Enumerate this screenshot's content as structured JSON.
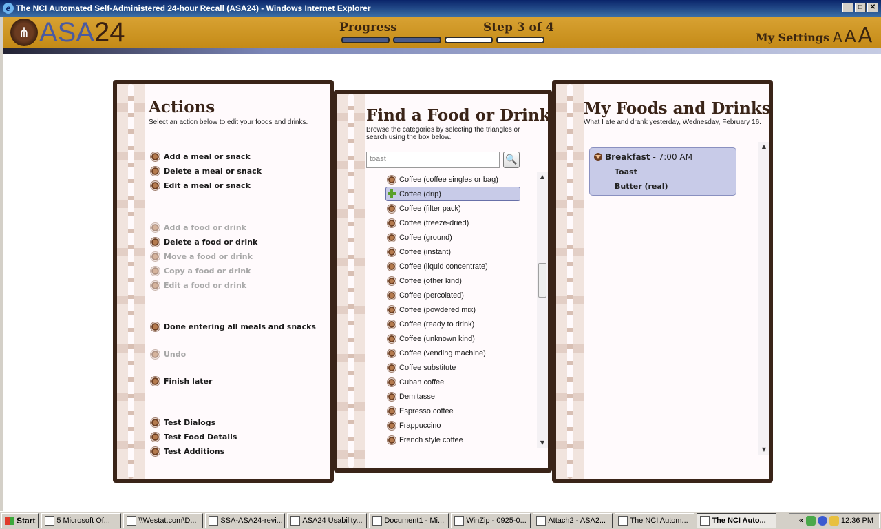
{
  "window": {
    "title": "The NCI Automated Self-Administered 24-hour Recall (ASA24) - Windows Internet Explorer"
  },
  "header": {
    "logo_text": "ASA",
    "logo_number": "24",
    "progress_label": "Progress",
    "step_label": "Step 3 of 4",
    "progress_completed": 2,
    "progress_total": 4,
    "my_settings": "My Settings",
    "font_size_small": "A",
    "font_size_medium": "A",
    "font_size_large": "A"
  },
  "actions_panel": {
    "title": "Actions",
    "subtitle": "Select an action below to edit your foods and drinks.",
    "items": [
      {
        "label": "Add a meal or snack",
        "enabled": true
      },
      {
        "label": "Delete a meal or snack",
        "enabled": true
      },
      {
        "label": "Edit a meal or snack",
        "enabled": true
      },
      {
        "label": "Add a food or drink",
        "enabled": false
      },
      {
        "label": "Delete a food or drink",
        "enabled": true
      },
      {
        "label": "Move a food or drink",
        "enabled": false
      },
      {
        "label": "Copy a food or drink",
        "enabled": false
      },
      {
        "label": "Edit a food or drink",
        "enabled": false
      },
      {
        "label": "Done entering all meals and snacks",
        "enabled": true
      },
      {
        "label": "Undo",
        "enabled": false
      },
      {
        "label": "Finish later",
        "enabled": true
      },
      {
        "label": "Test Dialogs",
        "enabled": true
      },
      {
        "label": "Test Food Details",
        "enabled": true
      },
      {
        "label": "Test Additions",
        "enabled": true
      }
    ]
  },
  "find_panel": {
    "title": "Find a Food or Drink",
    "subtitle": "Browse the categories by selecting the triangles or search using the box below.",
    "search_value": "toast",
    "foods": [
      "Coffee (coffee singles or bag)",
      "Coffee (drip)",
      "Coffee (filter pack)",
      "Coffee (freeze-dried)",
      "Coffee (ground)",
      "Coffee (instant)",
      "Coffee (liquid concentrate)",
      "Coffee (other kind)",
      "Coffee (percolated)",
      "Coffee (powdered mix)",
      "Coffee (ready to drink)",
      "Coffee (unknown kind)",
      "Coffee (vending machine)",
      "Coffee substitute",
      "Cuban coffee",
      "Demitasse",
      "Espresso coffee",
      "Frappuccino",
      "French style coffee"
    ],
    "selected_index": 1
  },
  "my_foods_panel": {
    "title": "My Foods and Drinks",
    "subtitle": "What I ate and drank  yesterday, Wednesday, February 16.",
    "meal": {
      "name": "Breakfast",
      "time": "- 7:00 AM",
      "foods": [
        "Toast",
        "Butter (real)"
      ]
    }
  },
  "taskbar": {
    "start": "Start",
    "items": [
      {
        "label": "5 Microsoft Of...",
        "active": false
      },
      {
        "label": "\\\\Westat.com\\D...",
        "active": false
      },
      {
        "label": "SSA-ASA24-revi...",
        "active": false
      },
      {
        "label": "ASA24 Usability...",
        "active": false
      },
      {
        "label": "Document1 - Mi...",
        "active": false
      },
      {
        "label": "WinZip - 0925-0...",
        "active": false
      },
      {
        "label": "Attach2 - ASA2...",
        "active": false
      },
      {
        "label": "The NCI Autom...",
        "active": false
      },
      {
        "label": "The NCI Auto...",
        "active": true
      }
    ],
    "clock": "12:36 PM"
  }
}
